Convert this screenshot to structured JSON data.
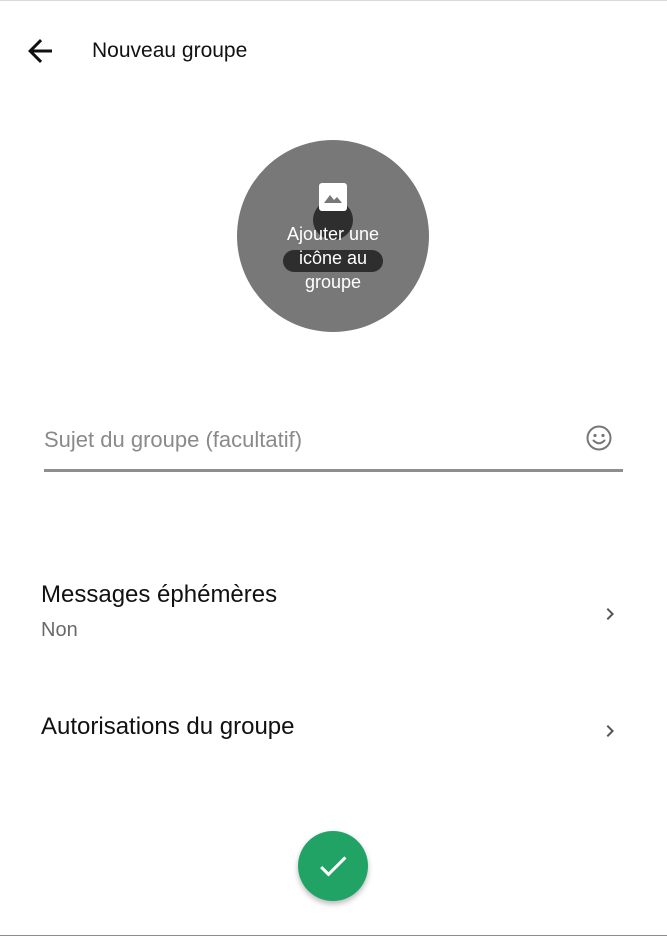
{
  "header": {
    "title": "Nouveau groupe",
    "back_icon": "arrow-back-icon"
  },
  "avatar": {
    "label_line1": "Ajouter une",
    "label_line2": "icône au",
    "label_line3": "groupe",
    "icon": "add-photo-icon",
    "background_color": "#787878"
  },
  "subject": {
    "placeholder": "Sujet du groupe (facultatif)",
    "value": "",
    "emoji_icon": "emoji-icon"
  },
  "settings": {
    "disappearing": {
      "title": "Messages éphémères",
      "value": "Non"
    },
    "permissions": {
      "title": "Autorisations du groupe"
    }
  },
  "fab": {
    "icon": "check-icon",
    "color": "#21a366"
  }
}
